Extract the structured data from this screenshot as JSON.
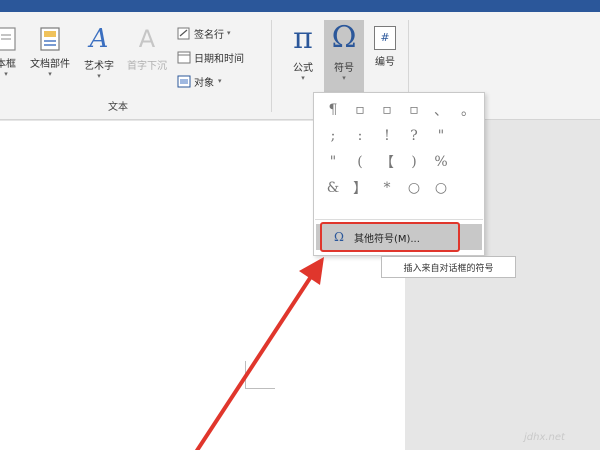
{
  "ribbon": {
    "group_text_label": "文本",
    "buttons": {
      "textbox": "本框",
      "quick_parts": "文档部件",
      "wordart": "艺术字",
      "dropcap": "首字下沉",
      "equation": "公式",
      "symbol": "符号",
      "number": "编号"
    },
    "small": {
      "signature": "签名行",
      "datetime": "日期和时间",
      "object": "对象"
    },
    "glyphs": {
      "pi": "π",
      "omega": "Ω",
      "number_icon": "#",
      "wordart_glyph": "A",
      "dropcap_glyph": "A"
    }
  },
  "symbol_dropdown": {
    "cells": [
      "¶",
      "▫",
      "▫",
      "▫",
      "、",
      "。",
      ";",
      ":",
      "!",
      "?",
      "\"",
      "",
      "\"",
      "(",
      "【",
      ")",
      "%",
      "",
      "&",
      "】",
      "*",
      "○",
      "○",
      ""
    ],
    "more_label": "其他符号(M)...",
    "more_icon": "Ω"
  },
  "tooltip": {
    "text": "插入来自对话框的符号"
  },
  "watermark": "jdhx.net",
  "colors": {
    "accent": "#2b579a",
    "highlight": "#e0362c"
  }
}
